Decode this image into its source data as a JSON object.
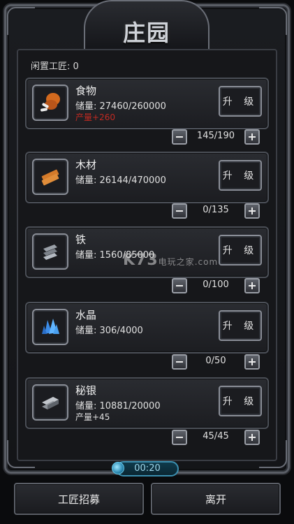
{
  "title": "庄园",
  "idle_label": "闲置工匠: 0",
  "upgrade_label": "升 级",
  "resources": [
    {
      "name": "食物",
      "stock": "储量: 27460/260000",
      "production": "产量+260",
      "production_style": "red",
      "workers": "145/190",
      "icon": "food-drumstick-icon"
    },
    {
      "name": "木材",
      "stock": "储量: 26144/470000",
      "production": "",
      "production_style": "",
      "workers": "0/135",
      "icon": "wood-plank-icon"
    },
    {
      "name": "铁",
      "stock": "储量: 1560/85000",
      "production": "",
      "production_style": "",
      "workers": "0/100",
      "icon": "iron-ingot-icon"
    },
    {
      "name": "水晶",
      "stock": "储量: 306/4000",
      "production": "",
      "production_style": "",
      "workers": "0/50",
      "icon": "crystal-icon"
    },
    {
      "name": "秘银",
      "stock": "储量: 10881/20000",
      "production": "产量+45",
      "production_style": "",
      "workers": "45/45",
      "icon": "mithril-ingot-icon"
    }
  ],
  "timer": "00:20",
  "recruit_label": "工匠招募",
  "leave_label": "离开",
  "watermark": {
    "brand": "K73",
    "sub": "电玩之家",
    "domain": ".com"
  }
}
